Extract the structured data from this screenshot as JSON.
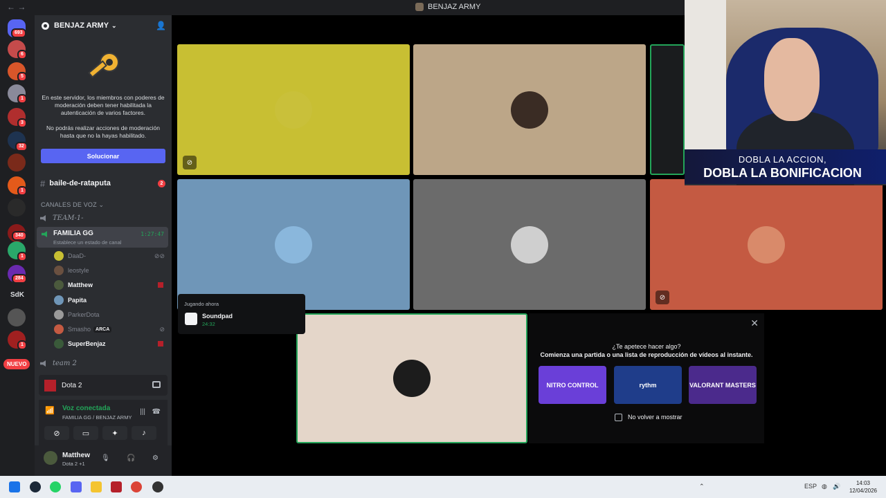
{
  "window": {
    "title": "BENJAZ ARMY"
  },
  "rail": {
    "badges": [
      "693",
      "6",
      "5",
      "1",
      "3",
      "32",
      "1",
      "340",
      "1",
      "284",
      "1"
    ],
    "sdk_label": "SdK",
    "new_label": "NUEVO"
  },
  "server": {
    "name": "BENJAZ ARMY",
    "mfa_message_1": "En este servidor, los miembros con poderes de moderación deben tener habilitada la autenticación de varios factores.",
    "mfa_message_2": "No podrás realizar acciones de moderación hasta que no la hayas habilitado.",
    "fix_button": "Solucionar"
  },
  "channels": {
    "text_channel": {
      "name": "baile-de-rataputa",
      "unread": "2"
    },
    "voice_category": "CANALES DE VOZ",
    "voice_channels": [
      {
        "name": "𝑇𝐸𝐴𝑀-1-"
      },
      {
        "name": "team 2"
      }
    ],
    "active_voice": {
      "name": "FAMILIA GG",
      "status_placeholder": "Establece un estado de canal",
      "duration": "1:27:47"
    },
    "members": [
      {
        "name": "DaaD-",
        "color": "#80848e"
      },
      {
        "name": "leostyle",
        "color": "#80848e"
      },
      {
        "name": "Matthew",
        "color": "#f2f3f5"
      },
      {
        "name": "Papita",
        "color": "#f2f3f5"
      },
      {
        "name": "ParkerDota",
        "color": "#80848e"
      },
      {
        "name": "Smasho",
        "color": "#80848e",
        "tag": "ARCA"
      },
      {
        "name": "SuperBenjaz",
        "color": "#f2f3f5"
      }
    ]
  },
  "activity": {
    "game": "Dota 2"
  },
  "voice_panel": {
    "status": "Voz conectada",
    "location": "FAMILIA GG / BENJAZ ARMY"
  },
  "user": {
    "name": "Matthew",
    "status": "Dota 2 +1"
  },
  "popup": {
    "heading": "Jugando ahora",
    "app": "Soundpad",
    "time": "24:32"
  },
  "suggestion": {
    "question": "¿Te apetece hacer algo?",
    "subtitle": "Comienza una partida o una lista de reproducción de vídeos al instante.",
    "cards": [
      {
        "label": "NITRO CONTROL",
        "color": "#6a3fd8"
      },
      {
        "label": "rythm",
        "color": "#1f3d8a"
      },
      {
        "label": "VALORANT MASTERS",
        "color": "#4b2a8c"
      }
    ],
    "checkbox_label": "No volver a mostrar"
  },
  "overlay": {
    "line1": "DOBLA LA ACCION,",
    "line2": "DOBLA LA BONIFICACION"
  },
  "taskbar": {
    "language": "ESP",
    "time": "14:03",
    "date": "12/04/2026"
  },
  "tiles": [
    {
      "bg": "#c8bf33",
      "avatar": "#c9c03a"
    },
    {
      "bg": "#bca688",
      "avatar": "#3a2c24"
    },
    {
      "bg": "#6f96b8",
      "avatar": "#8ab7dc"
    },
    {
      "bg": "#6b6b6b",
      "avatar": "#cfcfcf"
    },
    {
      "bg": "#c45a42",
      "avatar": "#d98a6a"
    },
    {
      "bg": "#e4d6c9",
      "avatar": "#1c1c1c"
    }
  ]
}
